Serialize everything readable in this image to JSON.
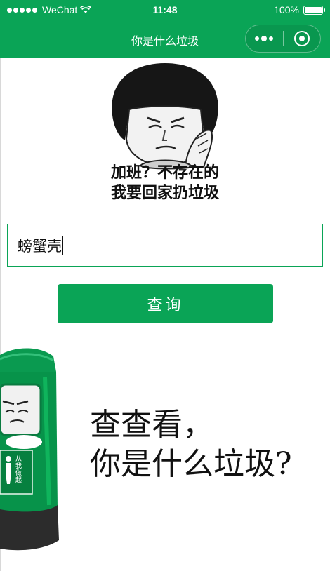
{
  "status_bar": {
    "carrier": "WeChat",
    "time": "11:48",
    "battery": "100%",
    "battery_level": 1.0
  },
  "nav": {
    "title": "你是什么垃圾"
  },
  "meme": {
    "line1": "加班？不存在的",
    "line2": "我要回家扔垃圾"
  },
  "search": {
    "value": "螃蟹壳"
  },
  "query_button": {
    "label": "查询"
  },
  "bin": {
    "sign_text": "从我做起"
  },
  "slogan": {
    "line1": "查查看，",
    "line2": "你是什么垃圾?"
  },
  "colors": {
    "brand_green": "#0aa456",
    "text": "#111111",
    "background": "#ffffff"
  }
}
